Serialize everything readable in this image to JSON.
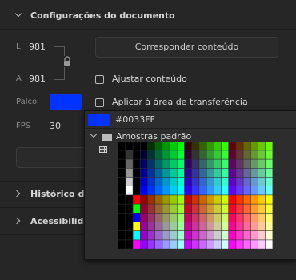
{
  "doc_settings": {
    "title": "Configurações do documento",
    "width_label": "L",
    "width_value": "981",
    "height_label": "A",
    "height_value": "981",
    "stage_label": "Palco",
    "stage_color": "#0033FF",
    "fps_label": "FPS",
    "fps_value": "30",
    "match_button": "Corresponder conteúdo",
    "fit_content_label": "Ajustar conteúdo",
    "apply_clipboard_label": "Aplicar à área de transferência"
  },
  "sections": {
    "history": "Histórico de S",
    "accessibility": "Acessibilidad"
  },
  "color_picker": {
    "hex_value": "#0033FF",
    "swatch_group": "Amostras padrão",
    "icons": [
      "folder-icon",
      "swatch-grid-icon",
      "chevron-down-icon"
    ]
  }
}
